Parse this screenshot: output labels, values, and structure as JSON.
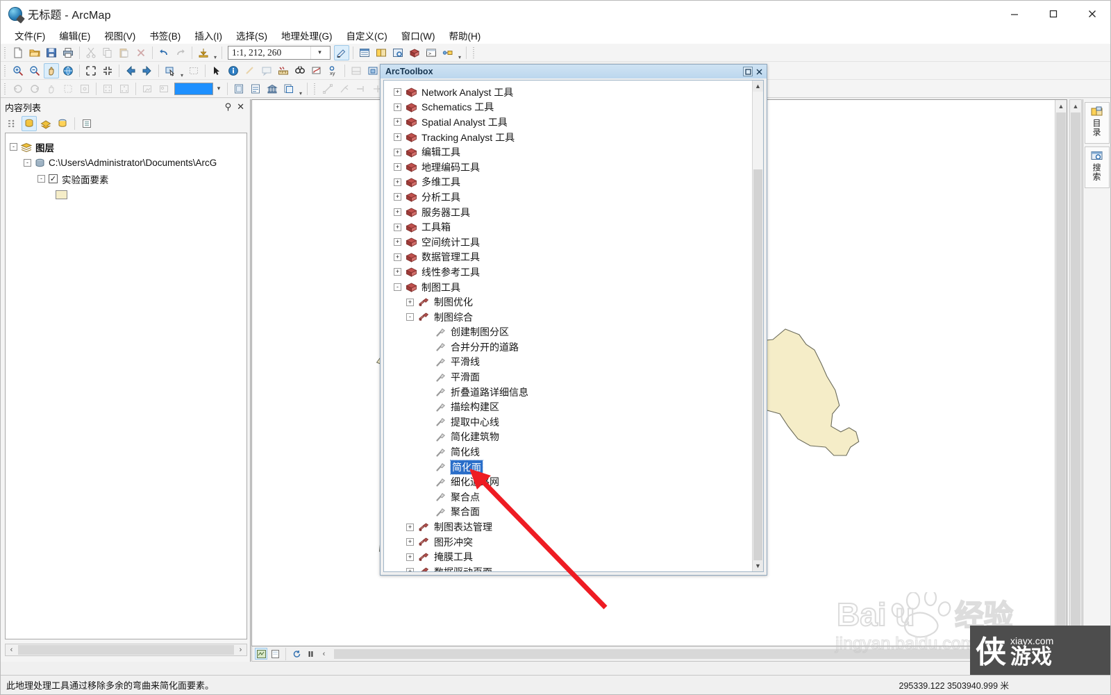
{
  "window": {
    "title": "无标题 - ArcMap",
    "app_icon": "arcmap-globe-icon",
    "minimize_label": "最小化",
    "maximize_label": "最大化",
    "close_label": "关闭"
  },
  "menubar": {
    "items": [
      {
        "label": "文件(F)",
        "name": "menu-file"
      },
      {
        "label": "编辑(E)",
        "name": "menu-edit"
      },
      {
        "label": "视图(V)",
        "name": "menu-view"
      },
      {
        "label": "书签(B)",
        "name": "menu-bookmarks"
      },
      {
        "label": "插入(I)",
        "name": "menu-insert"
      },
      {
        "label": "选择(S)",
        "name": "menu-selection"
      },
      {
        "label": "地理处理(G)",
        "name": "menu-geoprocessing"
      },
      {
        "label": "自定义(C)",
        "name": "menu-customize"
      },
      {
        "label": "窗口(W)",
        "name": "menu-window"
      },
      {
        "label": "帮助(H)",
        "name": "menu-help"
      }
    ]
  },
  "toolbar": {
    "scale_value": "1:1, 212, 260",
    "scale_placeholder": "1:1, 212, 260",
    "arctoolbox_tab_label": "ArcToolbo",
    "fill_color": "#1e90ff",
    "row1_icons": [
      "new-map-icon",
      "open-icon",
      "save-icon",
      "print-icon",
      "cut-icon",
      "copy-icon",
      "paste-icon",
      "delete-icon",
      "undo-icon",
      "redo-icon",
      "add-data-icon",
      "editor-toolbar-icon",
      "table-of-contents-icon",
      "catalog-icon",
      "search-icon",
      "arctoolbox-icon",
      "python-window-icon",
      "modelbuilder-icon"
    ],
    "row2_icons": [
      "zoom-in-icon",
      "zoom-out-icon",
      "pan-icon",
      "full-extent-icon",
      "fixed-zoom-in-icon",
      "fixed-zoom-out-icon",
      "go-back-icon",
      "go-forward-icon",
      "select-features-icon",
      "clear-selection-icon",
      "select-elements-icon",
      "identify-icon",
      "hyperlink-icon",
      "html-popup-icon",
      "measure-icon",
      "find-icon",
      "find-route-icon",
      "go-to-xy-icon",
      "time-slider-icon",
      "create-viewer-icon"
    ],
    "row3_icons": [
      "rotate-left-icon",
      "rotate-right-icon",
      "pan-3d-icon",
      "zoom-extent-icon",
      "target-icon",
      "grid-icon",
      "grid2-icon",
      "frame-icon",
      "frame2-icon",
      "fill-color-icon",
      "page-icon",
      "report-icon",
      "bank-icon",
      "print-preview-icon",
      "trace-icon",
      "split-icon",
      "extend-icon",
      "intersect-icon",
      "line-icon",
      "scatter-icon",
      "sphere-icon"
    ]
  },
  "toc": {
    "title": "内容列表",
    "pin_icon": "pin-icon",
    "close_icon": "close-icon",
    "tools": [
      "list-by-drawing-order-icon",
      "list-by-source-icon",
      "list-by-visibility-icon",
      "list-by-selection-icon",
      "options-icon"
    ],
    "tree": [
      {
        "label": "图层",
        "level": 0,
        "expander": "-",
        "icon": "layers-icon",
        "bold": true,
        "checkbox": null
      },
      {
        "label": "C:\\Users\\Administrator\\Documents\\ArcG",
        "level": 1,
        "expander": "-",
        "icon": "geodatabase-icon",
        "bold": false,
        "checkbox": null
      },
      {
        "label": "实验面要素",
        "level": 2,
        "expander": "-",
        "icon": null,
        "bold": false,
        "checkbox": "checked"
      },
      {
        "label": "",
        "level": 3,
        "expander": null,
        "icon": "polygon-swatch",
        "bold": false,
        "checkbox": null
      }
    ],
    "legend_swatch_color": "#f5edc8"
  },
  "arctoolbox": {
    "title": "ArcToolbox",
    "restore_icon": "restore-icon",
    "close_icon": "close-icon",
    "tree": [
      {
        "label": "Network Analyst 工具",
        "level": 0,
        "expander": "+",
        "icon": "toolbox-icon"
      },
      {
        "label": "Schematics 工具",
        "level": 0,
        "expander": "+",
        "icon": "toolbox-icon"
      },
      {
        "label": "Spatial Analyst 工具",
        "level": 0,
        "expander": "+",
        "icon": "toolbox-icon"
      },
      {
        "label": "Tracking Analyst 工具",
        "level": 0,
        "expander": "+",
        "icon": "toolbox-icon"
      },
      {
        "label": "编辑工具",
        "level": 0,
        "expander": "+",
        "icon": "toolbox-icon"
      },
      {
        "label": "地理编码工具",
        "level": 0,
        "expander": "+",
        "icon": "toolbox-icon"
      },
      {
        "label": "多维工具",
        "level": 0,
        "expander": "+",
        "icon": "toolbox-icon"
      },
      {
        "label": "分析工具",
        "level": 0,
        "expander": "+",
        "icon": "toolbox-icon"
      },
      {
        "label": "服务器工具",
        "level": 0,
        "expander": "+",
        "icon": "toolbox-icon"
      },
      {
        "label": "工具箱",
        "level": 0,
        "expander": "+",
        "icon": "toolbox-icon"
      },
      {
        "label": "空间统计工具",
        "level": 0,
        "expander": "+",
        "icon": "toolbox-icon"
      },
      {
        "label": "数据管理工具",
        "level": 0,
        "expander": "+",
        "icon": "toolbox-icon"
      },
      {
        "label": "线性参考工具",
        "level": 0,
        "expander": "+",
        "icon": "toolbox-icon"
      },
      {
        "label": "制图工具",
        "level": 0,
        "expander": "-",
        "icon": "toolbox-icon"
      },
      {
        "label": "制图优化",
        "level": 1,
        "expander": "+",
        "icon": "toolset-icon"
      },
      {
        "label": "制图综合",
        "level": 1,
        "expander": "-",
        "icon": "toolset-icon"
      },
      {
        "label": "创建制图分区",
        "level": 2,
        "expander": null,
        "icon": "tool-icon"
      },
      {
        "label": "合并分开的道路",
        "level": 2,
        "expander": null,
        "icon": "tool-icon"
      },
      {
        "label": "平滑线",
        "level": 2,
        "expander": null,
        "icon": "tool-icon"
      },
      {
        "label": "平滑面",
        "level": 2,
        "expander": null,
        "icon": "tool-icon"
      },
      {
        "label": "折叠道路详细信息",
        "level": 2,
        "expander": null,
        "icon": "tool-icon"
      },
      {
        "label": "描绘构建区",
        "level": 2,
        "expander": null,
        "icon": "tool-icon"
      },
      {
        "label": "提取中心线",
        "level": 2,
        "expander": null,
        "icon": "tool-icon"
      },
      {
        "label": "简化建筑物",
        "level": 2,
        "expander": null,
        "icon": "tool-icon"
      },
      {
        "label": "简化线",
        "level": 2,
        "expander": null,
        "icon": "tool-icon"
      },
      {
        "label": "简化面",
        "level": 2,
        "expander": null,
        "icon": "tool-icon",
        "selected": true
      },
      {
        "label": "细化道路网",
        "level": 2,
        "expander": null,
        "icon": "tool-icon"
      },
      {
        "label": "聚合点",
        "level": 2,
        "expander": null,
        "icon": "tool-icon"
      },
      {
        "label": "聚合面",
        "level": 2,
        "expander": null,
        "icon": "tool-icon"
      },
      {
        "label": "制图表达管理",
        "level": 1,
        "expander": "+",
        "icon": "toolset-icon"
      },
      {
        "label": "图形冲突",
        "level": 1,
        "expander": "+",
        "icon": "toolset-icon"
      },
      {
        "label": "掩膜工具",
        "level": 1,
        "expander": "+",
        "icon": "toolset-icon"
      },
      {
        "label": "数据驱动页面",
        "level": 1,
        "expander": "+",
        "icon": "toolset-icon"
      }
    ]
  },
  "map": {
    "polygon_fill": "#f5edc8",
    "polygon_stroke": "#6b6b5a",
    "view_buttons": [
      "data-view-icon",
      "layout-view-icon",
      "refresh-icon",
      "pause-drawing-icon"
    ]
  },
  "side_tabs": [
    {
      "label": "目录",
      "icon": "catalog-icon",
      "name": "side-tab-catalog"
    },
    {
      "label": "搜索",
      "icon": "search-icon",
      "name": "side-tab-search"
    }
  ],
  "statusbar": {
    "message": "此地理处理工具通过移除多余的弯曲来简化面要素。",
    "coordinates": "295339.122  3503940.999 米"
  },
  "watermarks": {
    "baidu_line1": "Baidu 经验",
    "baidu_line2": "jingyan.baidu.com",
    "xiayx_domain": "xiayx.com",
    "xiayx_char": "侠",
    "xiayx_word": "游戏"
  },
  "annotation": {
    "arrow_color": "#ee1c23",
    "arrow_description": "red-pointer-arrow"
  }
}
